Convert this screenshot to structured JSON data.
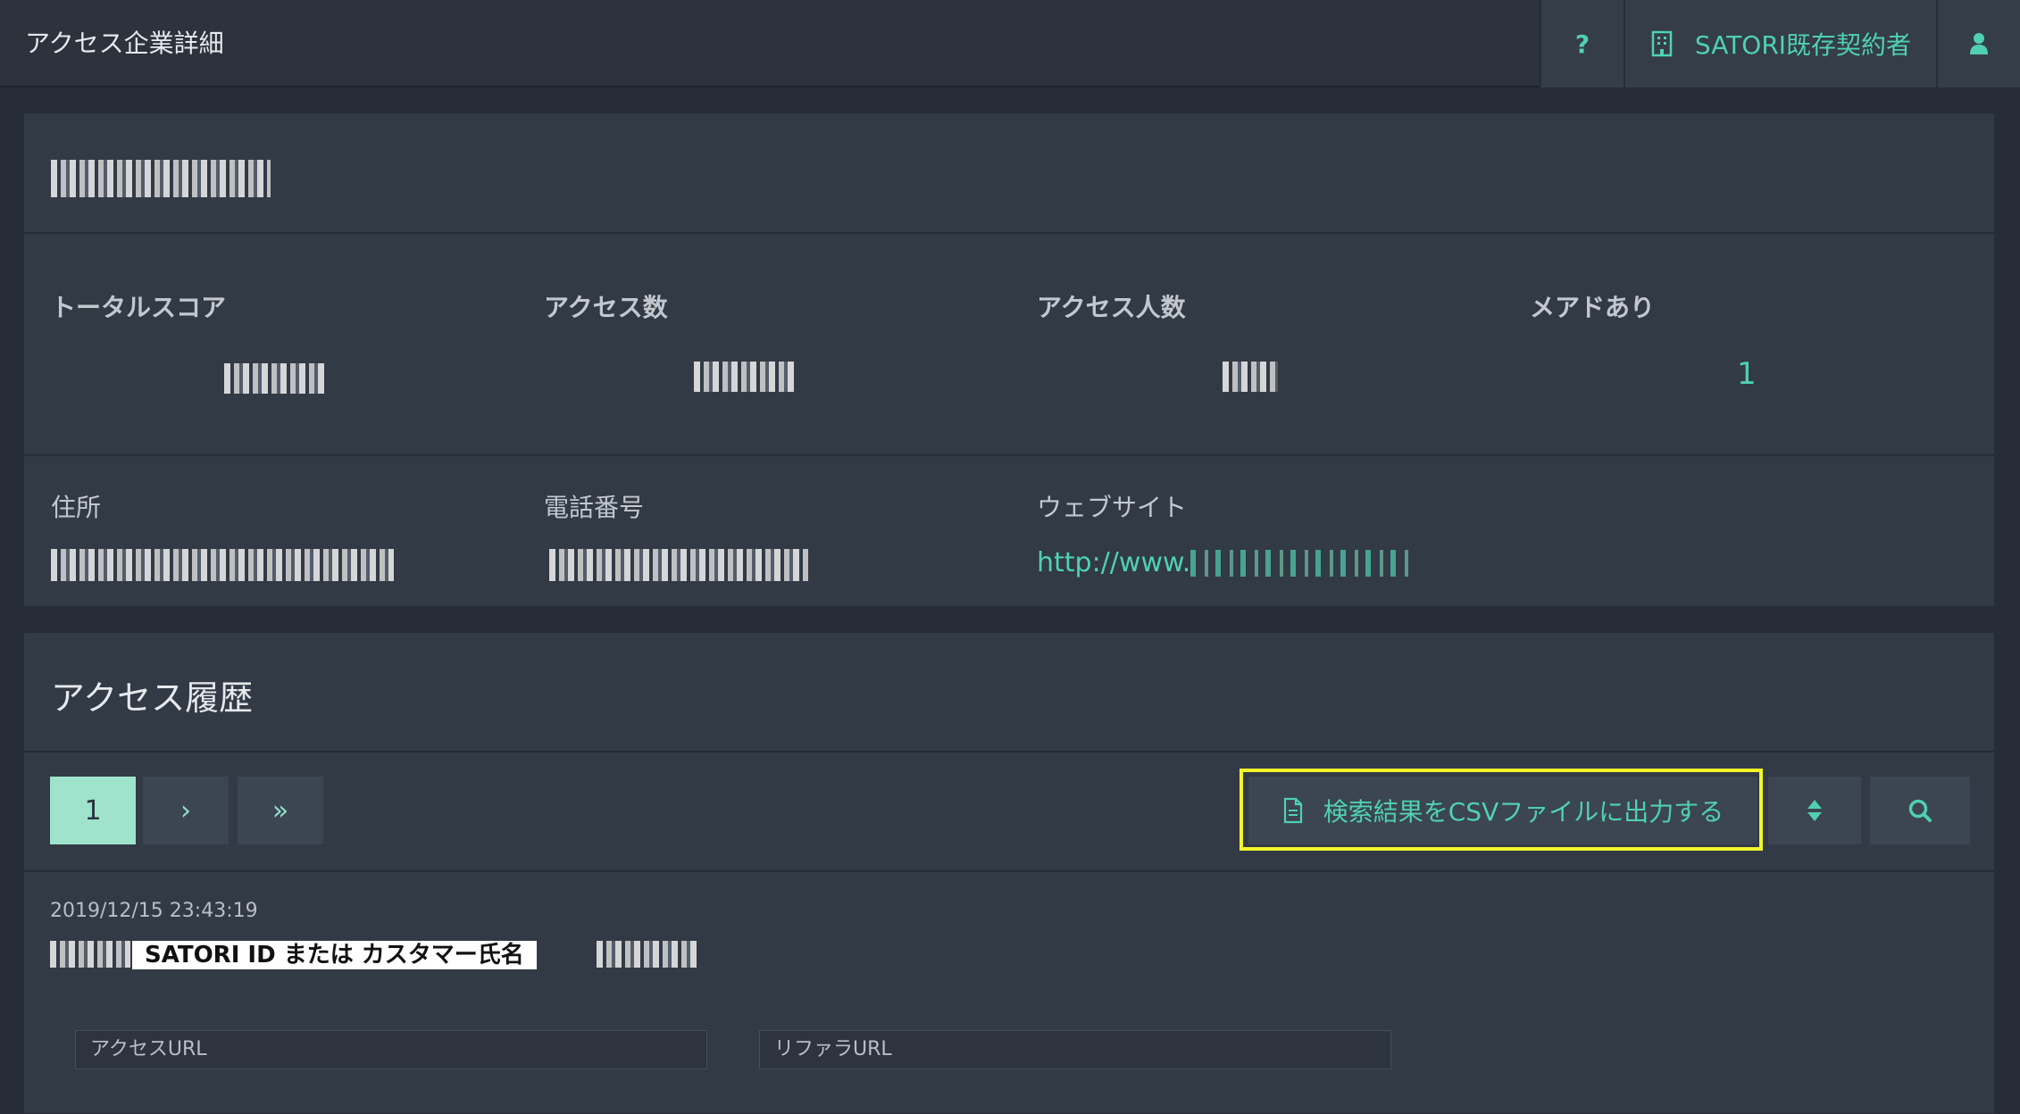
{
  "header": {
    "title": "アクセス企業詳細",
    "help_label": "?",
    "account_label": "SATORI既存契約者"
  },
  "company": {
    "summary_labels": {
      "total_score": "トータルスコア",
      "access_count": "アクセス数",
      "access_people": "アクセス人数",
      "has_email": "メアドあり"
    },
    "has_email_value": "1",
    "info_labels": {
      "address": "住所",
      "phone": "電話番号",
      "website": "ウェブサイト"
    },
    "website_prefix": "http://www."
  },
  "history": {
    "title": "アクセス履歴",
    "pagination": {
      "current": "1",
      "next": "›",
      "last": "»"
    },
    "csv_button_label": "検索結果をCSVファイルに出力する",
    "entry": {
      "timestamp": "2019/12/15 23:43:19",
      "name_label": "SATORI ID または カスタマー氏名",
      "access_url_label": "アクセスURL",
      "referrer_url_label": "リファラURL"
    }
  },
  "colors": {
    "accent": "#4fd1b0",
    "highlight": "#f2f52a",
    "background": "#272d36",
    "panel": "#323a45"
  },
  "icons": [
    "question-icon",
    "building-icon",
    "user-icon",
    "document-icon",
    "sort-icon",
    "search-icon"
  ]
}
